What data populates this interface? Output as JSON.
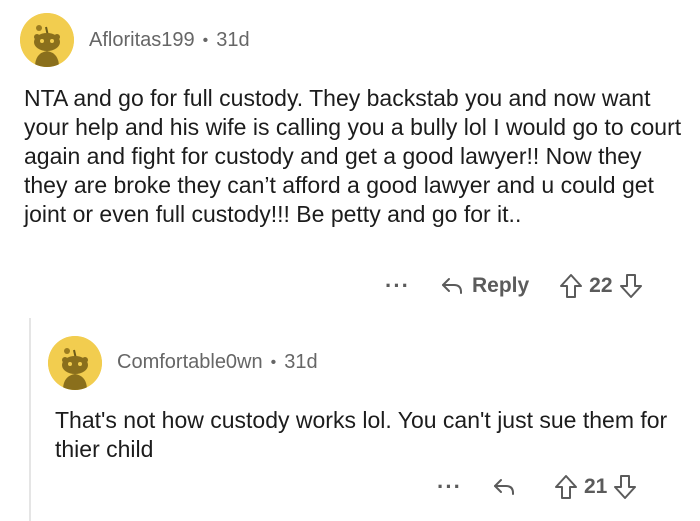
{
  "comments": [
    {
      "username": "Afloritas199",
      "age": "31d",
      "separator": "•",
      "text": "NTA and go for full custody. They backstab you and now want your help and his wife is calling you a bully lol I would go to court again and fight for custody and get a good lawyer!! Now they they are broke they can’t afford a good lawyer and u could get joint or even full custody!!! Be petty and go for it..",
      "more_label": "···",
      "reply_label": "Reply",
      "score": "22",
      "avatar_color": "#f2cd4f"
    },
    {
      "username": "Comfortable0wn",
      "age": "31d",
      "separator": "•",
      "text": "That's not how custody works lol. You can't  just sue them for thier child",
      "more_label": "···",
      "score": "21",
      "avatar_color": "#f2cd4f"
    }
  ],
  "icons": {
    "reply": "reply-arrow-icon",
    "upvote": "upvote-arrow-icon",
    "downvote": "downvote-arrow-icon",
    "avatar": "snoo-avatar-icon"
  }
}
